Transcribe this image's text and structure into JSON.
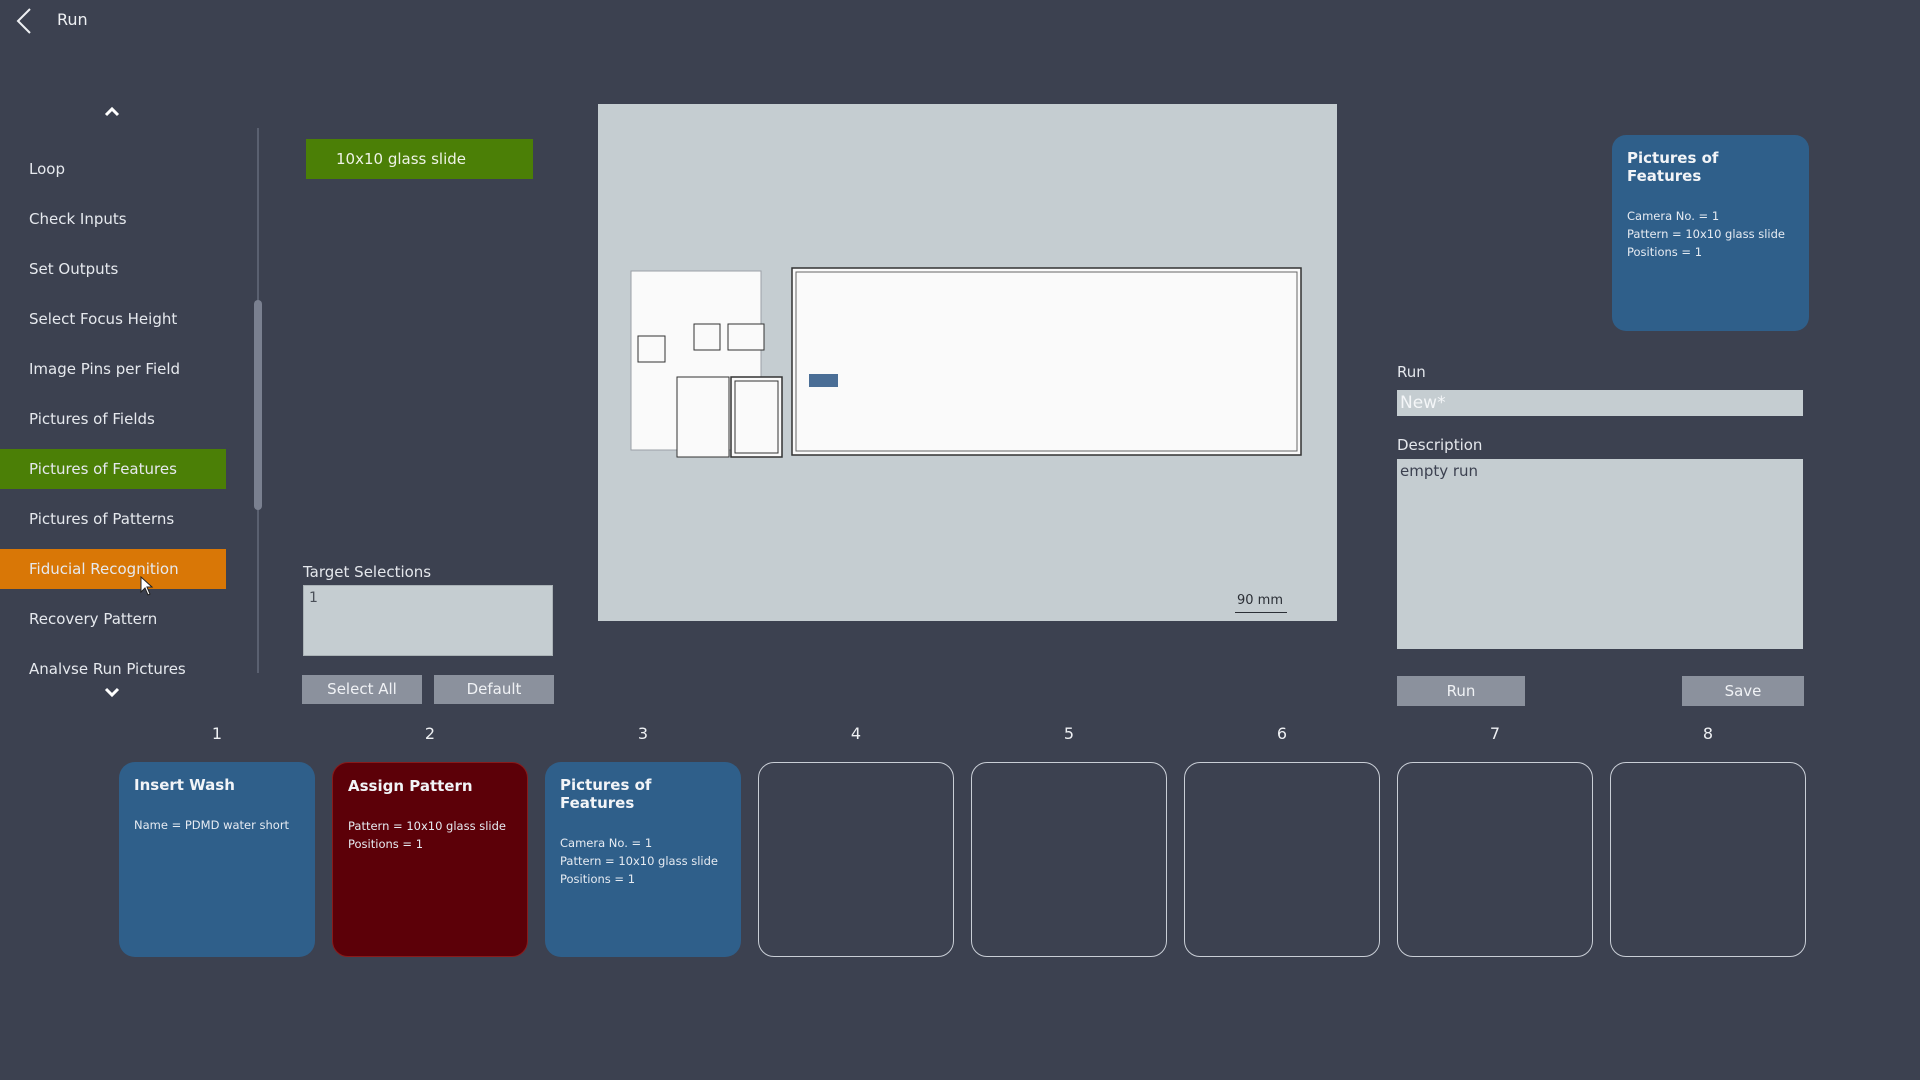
{
  "header": {
    "title": "Run",
    "back_icon": "chevron-left-icon"
  },
  "sidebar": {
    "up_icon": "chevron-up-icon",
    "down_icon": "chevron-down-icon",
    "items": [
      {
        "label": "Loop",
        "state": "normal"
      },
      {
        "label": "Check Inputs",
        "state": "normal"
      },
      {
        "label": "Set Outputs",
        "state": "normal"
      },
      {
        "label": "Select Focus Height",
        "state": "normal"
      },
      {
        "label": "Image Pins per Field",
        "state": "normal"
      },
      {
        "label": "Pictures of Fields",
        "state": "normal"
      },
      {
        "label": "Pictures of Features",
        "state": "selected"
      },
      {
        "label": "Pictures of Patterns",
        "state": "normal"
      },
      {
        "label": "Fiducial Recognition",
        "state": "hover"
      },
      {
        "label": "Recovery Pattern",
        "state": "normal"
      },
      {
        "label": "Analyse Run Pictures",
        "state": "normal"
      }
    ]
  },
  "pattern_button": {
    "label": "10x10 glass slide"
  },
  "target_selections": {
    "label": "Target Selections",
    "value": "1",
    "select_all_label": "Select All",
    "default_label": "Default"
  },
  "canvas": {
    "scale_label": "90 mm"
  },
  "selected_card": {
    "title": "Pictures of Features",
    "lines": [
      "Camera No. = 1",
      "Pattern = 10x10 glass slide",
      "Positions = 1"
    ]
  },
  "run": {
    "label": "Run",
    "value": "New*",
    "description_label": "Description",
    "description_value": "empty run",
    "run_button": "Run",
    "save_button": "Save"
  },
  "steps": [
    {
      "number": "1",
      "title": "Insert Wash",
      "lines": [
        "Name = PDMD water short"
      ],
      "style": "blue"
    },
    {
      "number": "2",
      "title": "Assign Pattern",
      "lines": [
        "Pattern = 10x10 glass slide",
        "Positions = 1"
      ],
      "style": "red"
    },
    {
      "number": "3",
      "title": "Pictures of Features",
      "lines": [
        "Camera No. = 1",
        "Pattern = 10x10 glass slide",
        "Positions = 1"
      ],
      "style": "blue"
    },
    {
      "number": "4",
      "title": "",
      "lines": [],
      "style": "empty"
    },
    {
      "number": "5",
      "title": "",
      "lines": [],
      "style": "empty"
    },
    {
      "number": "6",
      "title": "",
      "lines": [],
      "style": "empty"
    },
    {
      "number": "7",
      "title": "",
      "lines": [],
      "style": "empty"
    },
    {
      "number": "8",
      "title": "",
      "lines": [],
      "style": "empty"
    }
  ],
  "colors": {
    "background": "#3c4150",
    "selected_green": "#4b7f06",
    "hover_orange": "#d97706",
    "card_blue": "#2f5f8a",
    "card_red": "#5c0008",
    "input_bg": "#c5cdd1"
  }
}
